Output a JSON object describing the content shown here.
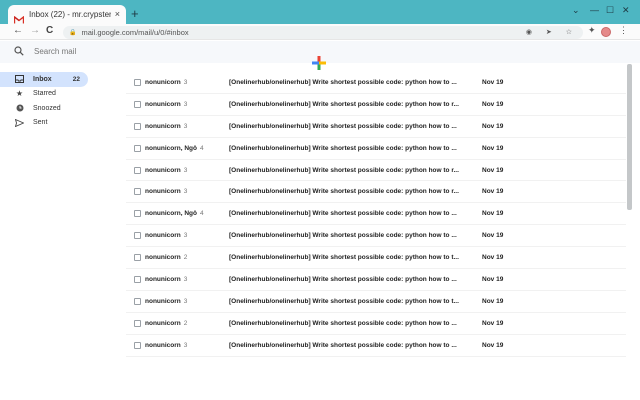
{
  "browser": {
    "tab_title": "Inbox (22) - mr.crypster@...",
    "tab_close": "×",
    "new_tab": "+",
    "url": "mail.google.com/mail/u/0/#inbox",
    "window_controls": [
      "⌄",
      "—",
      "☐",
      "✕"
    ],
    "nav": {
      "back": "←",
      "forward": "→",
      "reload": "C"
    },
    "lock": "🔒",
    "omni_icons": "◉ ➤ ☆",
    "menu": "⋮",
    "extensions": "✦"
  },
  "search": {
    "placeholder": "Search mail"
  },
  "sidebar": {
    "items": [
      {
        "label": "Inbox",
        "count": "22",
        "icon": "inbox-icon"
      },
      {
        "label": "Starred",
        "count": "",
        "icon": "star-icon"
      },
      {
        "label": "Snoozed",
        "count": "",
        "icon": "clock-icon"
      },
      {
        "label": "Sent",
        "count": "",
        "icon": "send-icon"
      }
    ]
  },
  "mails": [
    {
      "sender": "nonunicorn",
      "count": "3",
      "subject": "[Onelinerhub/onelinerhub] Write shortest possible code: python how to ...",
      "date": "Nov 19"
    },
    {
      "sender": "nonunicorn",
      "count": "3",
      "subject": "[Onelinerhub/onelinerhub] Write shortest possible code: python how to r...",
      "date": "Nov 19"
    },
    {
      "sender": "nonunicorn",
      "count": "3",
      "subject": "[Onelinerhub/onelinerhub] Write shortest possible code: python how to ...",
      "date": "Nov 19"
    },
    {
      "sender": "nonunicorn, Ngô",
      "count": "4",
      "subject": "[Onelinerhub/onelinerhub] Write shortest possible code: python how to ...",
      "date": "Nov 19"
    },
    {
      "sender": "nonunicorn",
      "count": "3",
      "subject": "[Onelinerhub/onelinerhub] Write shortest possible code: python how to r...",
      "date": "Nov 19"
    },
    {
      "sender": "nonunicorn",
      "count": "3",
      "subject": "[Onelinerhub/onelinerhub] Write shortest possible code: python how to r...",
      "date": "Nov 19"
    },
    {
      "sender": "nonunicorn, Ngô",
      "count": "4",
      "subject": "[Onelinerhub/onelinerhub] Write shortest possible code: python how to ...",
      "date": "Nov 19"
    },
    {
      "sender": "nonunicorn",
      "count": "3",
      "subject": "[Onelinerhub/onelinerhub] Write shortest possible code: python how to ...",
      "date": "Nov 19"
    },
    {
      "sender": "nonunicorn",
      "count": "2",
      "subject": "[Onelinerhub/onelinerhub] Write shortest possible code: python how to t...",
      "date": "Nov 19"
    },
    {
      "sender": "nonunicorn",
      "count": "3",
      "subject": "[Onelinerhub/onelinerhub] Write shortest possible code: python how to ...",
      "date": "Nov 19"
    },
    {
      "sender": "nonunicorn",
      "count": "3",
      "subject": "[Onelinerhub/onelinerhub] Write shortest possible code: python how to t...",
      "date": "Nov 19"
    },
    {
      "sender": "nonunicorn",
      "count": "2",
      "subject": "[Onelinerhub/onelinerhub] Write shortest possible code: python how to ...",
      "date": "Nov 19"
    },
    {
      "sender": "nonunicorn",
      "count": "3",
      "subject": "[Onelinerhub/onelinerhub] Write shortest possible code: python how to ...",
      "date": "Nov 19"
    }
  ],
  "colors": {
    "tabbar": "#4db6c2",
    "active_nav": "#d3e3fd",
    "search_bg": "#f6f8fb"
  }
}
